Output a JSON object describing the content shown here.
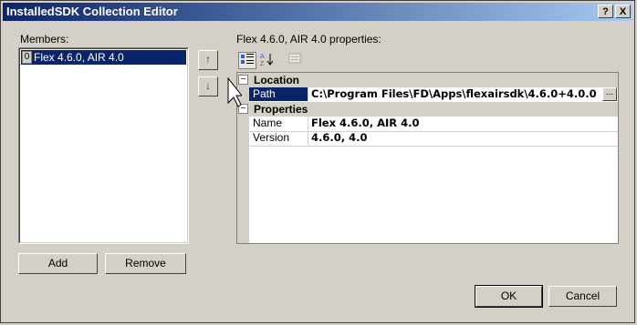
{
  "window": {
    "title": "InstalledSDK Collection Editor",
    "help_label": "?",
    "close_label": "X"
  },
  "members": {
    "label": "Members:",
    "items": [
      {
        "index": "0",
        "label": "Flex 4.6.0, AIR 4.0"
      }
    ],
    "move_up_icon": "↑",
    "move_down_icon": "↓"
  },
  "properties": {
    "heading": "Flex 4.6.0, AIR 4.0 properties:",
    "toolbar": {
      "categorized_icon": "categorized-icon",
      "alphabetical_icon": "alphabetical-icon",
      "pages_icon": "property-pages-icon"
    },
    "categories": [
      {
        "name": "Location",
        "toggle": "−",
        "rows": [
          {
            "name": "Path",
            "value": "C:\\Program Files\\FD\\Apps\\flexairsdk\\4.6.0+4.0.0",
            "ellipsis": "..."
          }
        ]
      },
      {
        "name": "Properties",
        "toggle": "−",
        "rows": [
          {
            "name": "Name",
            "value": "Flex 4.6.0, AIR 4.0"
          },
          {
            "name": "Version",
            "value": "4.6.0, 4.0"
          }
        ]
      }
    ]
  },
  "buttons": {
    "add": "Add",
    "remove": "Remove",
    "ok": "OK",
    "cancel": "Cancel"
  },
  "colors": {
    "selection": "#0a246a",
    "dialog_face": "#d4d0c8"
  }
}
